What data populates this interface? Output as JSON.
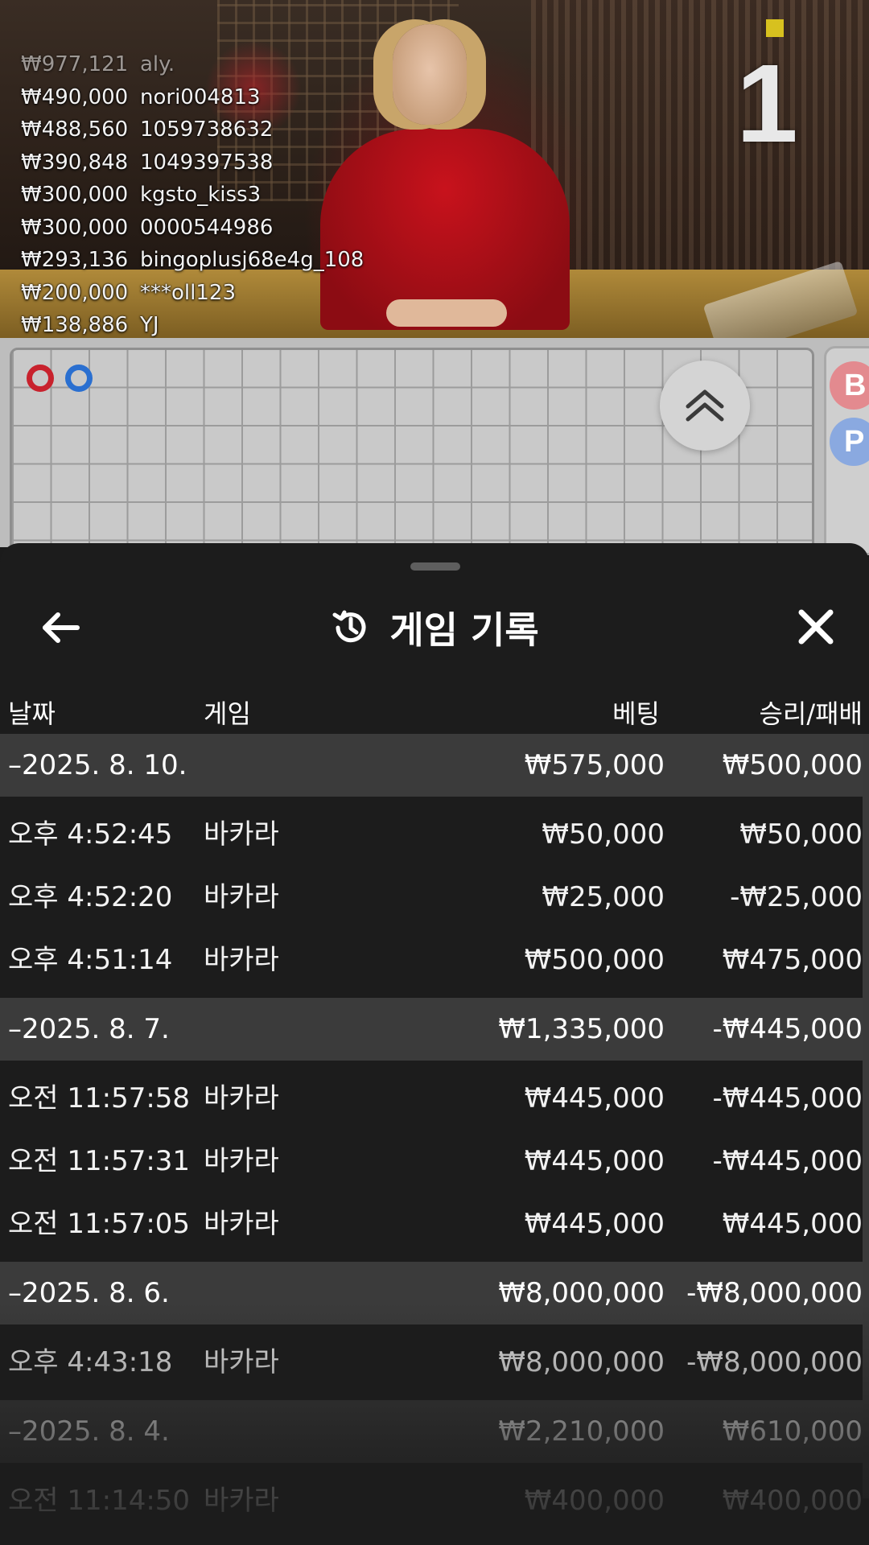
{
  "stream": {
    "round_number": "1",
    "leaderboard": [
      {
        "amount": "₩977,121",
        "name": "aly."
      },
      {
        "amount": "₩490,000",
        "name": "nori004813"
      },
      {
        "amount": "₩488,560",
        "name": "1059738632"
      },
      {
        "amount": "₩390,848",
        "name": "1049397538"
      },
      {
        "amount": "₩300,000",
        "name": "kgsto_kiss3"
      },
      {
        "amount": "₩300,000",
        "name": "0000544986"
      },
      {
        "amount": "₩293,136",
        "name": "bingoplusj68e4g_108"
      },
      {
        "amount": "₩200,000",
        "name": "***oll123"
      },
      {
        "amount": "₩138,886",
        "name": "YJ"
      }
    ]
  },
  "roadmap": {
    "side_buttons": {
      "banker": "B",
      "player": "P"
    }
  },
  "history": {
    "title": "게임 기록",
    "columns": {
      "date": "날짜",
      "game": "게임",
      "bet": "베팅",
      "win_loss": "승리/패배"
    },
    "groups": [
      {
        "date": "–2025. 8. 10.",
        "bet_total": "₩575,000",
        "win_loss_total": "₩500,000",
        "rows": [
          {
            "time": "오후 4:52:45",
            "game": "바카라",
            "bet": "₩50,000",
            "win_loss": "₩50,000"
          },
          {
            "time": "오후 4:52:20",
            "game": "바카라",
            "bet": "₩25,000",
            "win_loss": "-₩25,000"
          },
          {
            "time": "오후 4:51:14",
            "game": "바카라",
            "bet": "₩500,000",
            "win_loss": "₩475,000"
          }
        ]
      },
      {
        "date": "–2025. 8. 7.",
        "bet_total": "₩1,335,000",
        "win_loss_total": "-₩445,000",
        "rows": [
          {
            "time": "오전 11:57:58",
            "game": "바카라",
            "bet": "₩445,000",
            "win_loss": "-₩445,000"
          },
          {
            "time": "오전 11:57:31",
            "game": "바카라",
            "bet": "₩445,000",
            "win_loss": "-₩445,000"
          },
          {
            "time": "오전 11:57:05",
            "game": "바카라",
            "bet": "₩445,000",
            "win_loss": "₩445,000"
          }
        ]
      },
      {
        "date": "–2025. 8. 6.",
        "bet_total": "₩8,000,000",
        "win_loss_total": "-₩8,000,000",
        "rows": [
          {
            "time": "오후 4:43:18",
            "game": "바카라",
            "bet": "₩8,000,000",
            "win_loss": "-₩8,000,000"
          }
        ]
      },
      {
        "date": "–2025. 8. 4.",
        "bet_total": "₩2,210,000",
        "win_loss_total": "₩610,000",
        "rows": [
          {
            "time": "오전 11:14:50",
            "game": "바카라",
            "bet": "₩400,000",
            "win_loss": "₩400,000"
          }
        ]
      }
    ]
  }
}
